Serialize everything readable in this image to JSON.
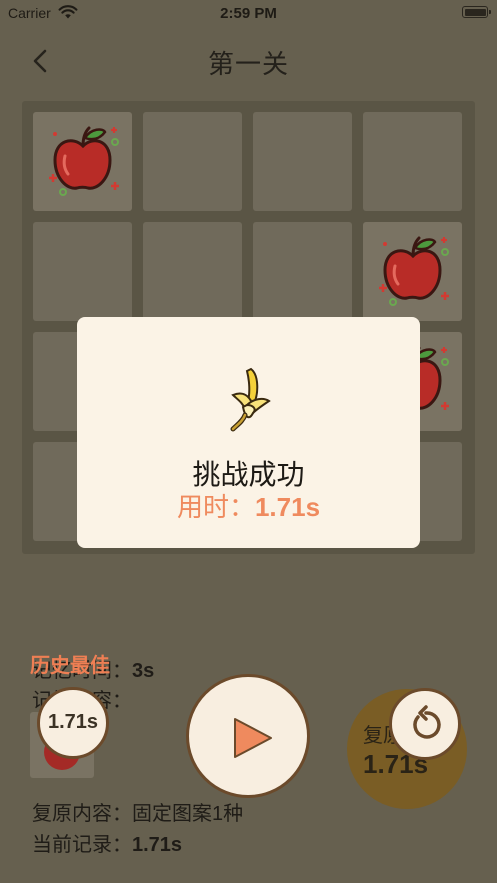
{
  "status_bar": {
    "carrier": "Carrier",
    "time": "2:59 PM"
  },
  "nav": {
    "title": "第一关",
    "back_icon": "chevron-left-icon"
  },
  "board": {
    "rows": 4,
    "cols": 4,
    "apple_cells": [
      [
        0,
        0
      ],
      [
        1,
        3
      ],
      [
        2,
        3
      ]
    ]
  },
  "modal": {
    "icon": "banana-icon",
    "title": "挑战成功",
    "time_label": "用时：",
    "time_value": "1.71s"
  },
  "history": {
    "label": "历史最佳",
    "memory_time_label": "记忆时间：",
    "memory_time_value": "3s",
    "memory_content_label": "记忆内容：",
    "best_time": "1.71s",
    "restore_content_label": "复原内容：",
    "restore_content_value": "固定图案1种",
    "current_record_label": "当前记录：",
    "current_record_value": "1.71s"
  },
  "restore_button": {
    "label": "复原",
    "value": "1.71s"
  },
  "colors": {
    "accent": "#ef8a5e",
    "background": "#66604f",
    "card": "#fbf3e6"
  }
}
